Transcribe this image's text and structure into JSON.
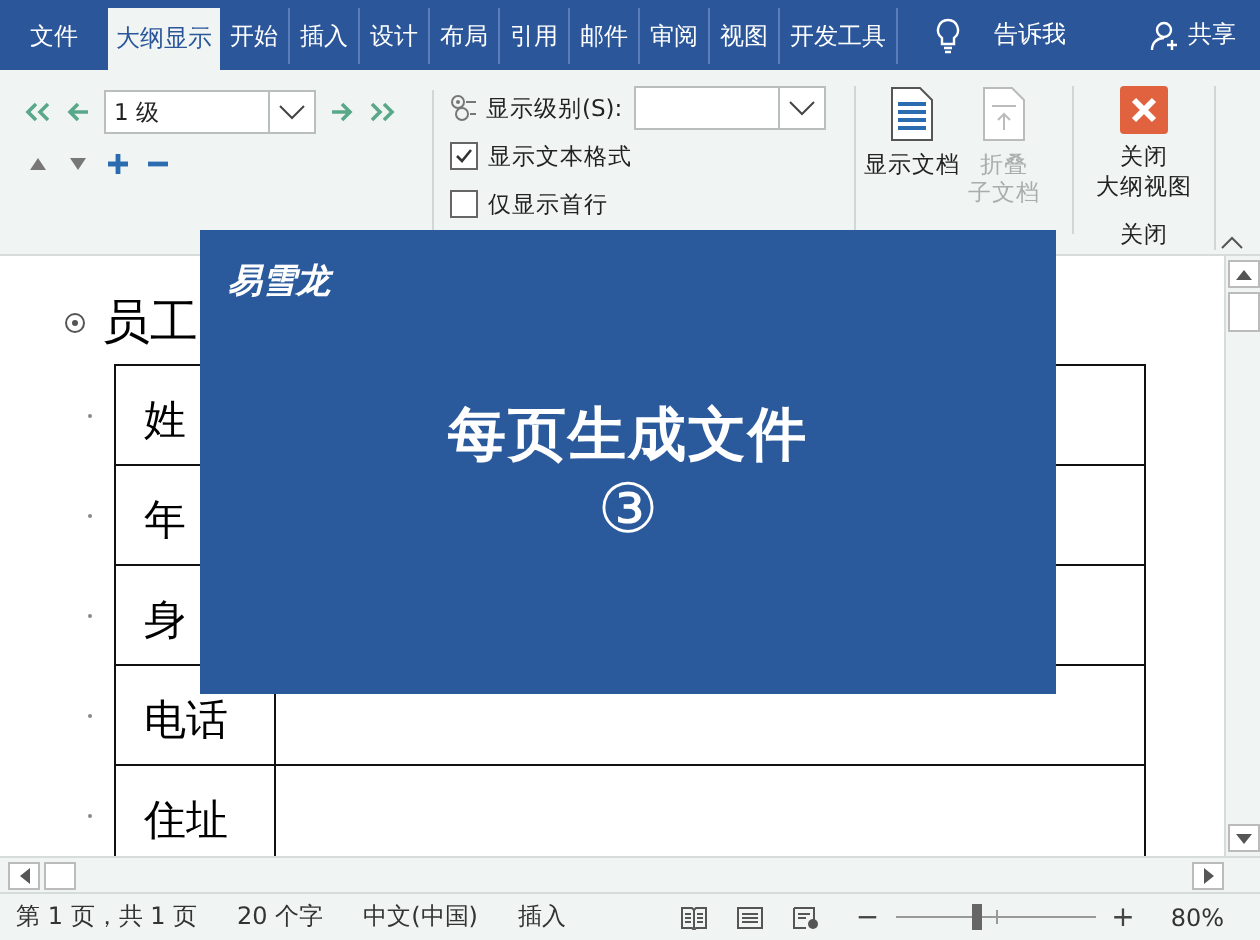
{
  "tabs": [
    {
      "label": "文件",
      "selected": false
    },
    {
      "label": "大纲显示",
      "selected": true
    },
    {
      "label": "开始",
      "selected": false
    },
    {
      "label": "插入",
      "selected": false
    },
    {
      "label": "设计",
      "selected": false
    },
    {
      "label": "布局",
      "selected": false
    },
    {
      "label": "引用",
      "selected": false
    },
    {
      "label": "邮件",
      "selected": false
    },
    {
      "label": "审阅",
      "selected": false
    },
    {
      "label": "视图",
      "selected": false
    },
    {
      "label": "开发工具",
      "selected": false
    }
  ],
  "tell_me": "告诉我",
  "share": "共享",
  "outline_tools": {
    "level_value": "1 级",
    "show_level_label": "显示级别(S):",
    "checkboxes": [
      {
        "label": "显示文本格式",
        "checked": true
      },
      {
        "label": "仅显示首行",
        "checked": false
      }
    ]
  },
  "master_document": [
    {
      "lines": [
        "显示文档"
      ],
      "disabled": false,
      "kind": "show"
    },
    {
      "lines": [
        "折叠",
        "子文档"
      ],
      "disabled": true,
      "kind": "collapse"
    }
  ],
  "close": {
    "lines": [
      "关闭",
      "大纲视图"
    ],
    "group_label": "关闭"
  },
  "document": {
    "heading": "员工",
    "rows": [
      {
        "label": "姓"
      },
      {
        "label": "年"
      },
      {
        "label": "身"
      },
      {
        "label": "电话"
      },
      {
        "label": "住址"
      }
    ]
  },
  "overlay": {
    "logo": "易雪龙",
    "title": "每页生成文件",
    "number": "③"
  },
  "status_bar": {
    "page": "第 1 页，共 1 页",
    "words": "20 个字",
    "language": "中文(中国)",
    "mode": "插入",
    "zoom_out": "−",
    "zoom_in": "+",
    "zoom": {
      "level": 0.4
    },
    "zoom_reading": "80%"
  }
}
